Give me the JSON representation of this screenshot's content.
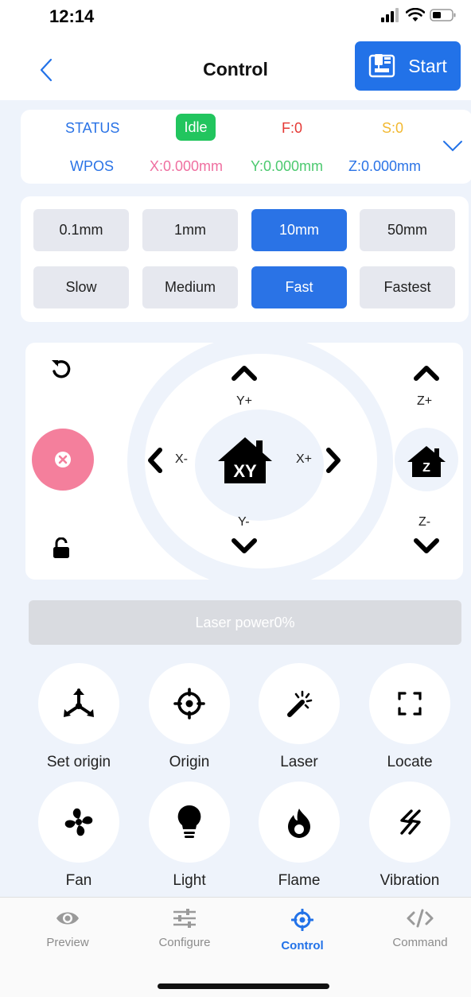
{
  "statusbar": {
    "time": "12:14"
  },
  "nav": {
    "title": "Control",
    "start_label": "Start"
  },
  "status": {
    "status_label": "STATUS",
    "state": "Idle",
    "feed": "F:0",
    "spindle": "S:0",
    "wpos_label": "WPOS",
    "x": "X:0.000mm",
    "y": "Y:0.000mm",
    "z": "Z:0.000mm"
  },
  "steps": [
    "0.1mm",
    "1mm",
    "10mm",
    "50mm"
  ],
  "speeds": [
    "Slow",
    "Medium",
    "Fast",
    "Fastest"
  ],
  "selected": {
    "step": "10mm",
    "speed": "Fast"
  },
  "jog": {
    "y_plus": "Y+",
    "y_minus": "Y-",
    "x_minus": "X-",
    "x_plus": "X+",
    "z_plus": "Z+",
    "z_minus": "Z-",
    "home_xy": "XY",
    "home_z": "Z"
  },
  "laser_power": "Laser power0%",
  "functions": [
    {
      "label": "Set origin",
      "icon": "set-origin-icon"
    },
    {
      "label": "Origin",
      "icon": "crosshair-icon"
    },
    {
      "label": "Laser",
      "icon": "magic-wand-icon"
    },
    {
      "label": "Locate",
      "icon": "frame-corners-icon"
    },
    {
      "label": "Fan",
      "icon": "fan-icon"
    },
    {
      "label": "Light",
      "icon": "lightbulb-icon"
    },
    {
      "label": "Flame",
      "icon": "flame-icon"
    },
    {
      "label": "Vibration",
      "icon": "vibration-icon"
    }
  ],
  "tabs": [
    {
      "label": "Preview",
      "icon": "eye-icon"
    },
    {
      "label": "Configure",
      "icon": "sliders-icon"
    },
    {
      "label": "Control",
      "icon": "crosshair-icon",
      "active": true
    },
    {
      "label": "Command",
      "icon": "code-icon"
    }
  ],
  "colors": {
    "accent": "#2272e8",
    "idle_badge": "#22c55e",
    "stop_button": "#f47f9c",
    "feed": "#e53935",
    "spindle": "#f2b830",
    "x_pos": "#ef6fa0",
    "y_pos": "#4cc96f",
    "status_label": "#2a73e6"
  }
}
